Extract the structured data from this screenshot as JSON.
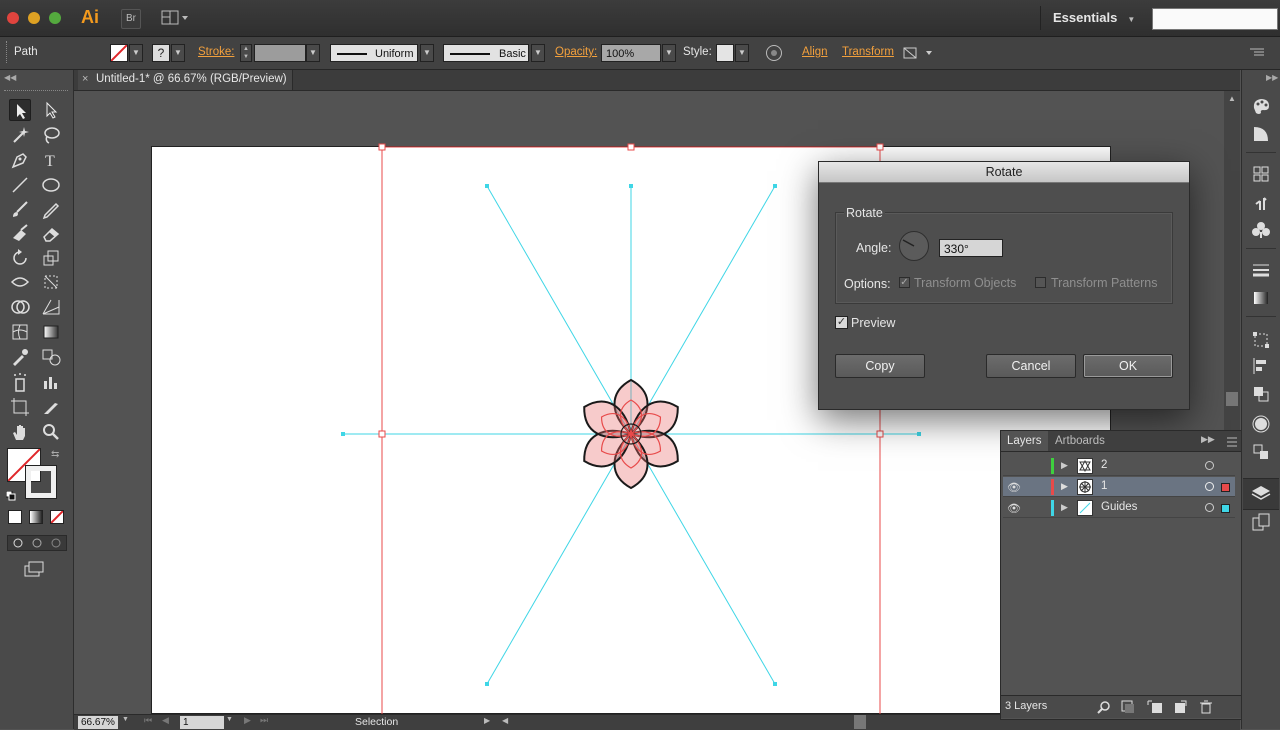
{
  "app": {
    "logo": "Ai",
    "bridge_label": "Br",
    "workspace": "Essentials",
    "search_placeholder": ""
  },
  "control_bar": {
    "selection_type": "Path",
    "stroke_label": "Stroke:",
    "stroke_profile": "Uniform",
    "brush": "Basic",
    "opacity_label": "Opacity:",
    "opacity_value": "100%",
    "style_label": "Style:",
    "align_label": "Align",
    "transform_label": "Transform"
  },
  "document": {
    "tab_title": "Untitled-1* @ 66.67% (RGB/Preview)",
    "close_glyph": "×"
  },
  "status_bar": {
    "zoom": "66.67%",
    "artboard_number": "1",
    "tool_status": "Selection"
  },
  "rotate_dialog": {
    "title": "Rotate",
    "group_label": "Rotate",
    "angle_label": "Angle:",
    "angle_value": "330°",
    "options_label": "Options:",
    "transform_objects": "Transform Objects",
    "transform_objects_checked": true,
    "transform_patterns": "Transform Patterns",
    "transform_patterns_checked": false,
    "preview_label": "Preview",
    "preview_checked": true,
    "copy_button": "Copy",
    "cancel_button": "Cancel",
    "ok_button": "OK"
  },
  "layers_panel": {
    "tabs": [
      "Layers",
      "Artboards"
    ],
    "layers": [
      {
        "name": "2",
        "visible": false,
        "color": "#3ecf3e",
        "selected": false
      },
      {
        "name": "1",
        "visible": true,
        "color": "#e84a4a",
        "selected": true
      },
      {
        "name": "Guides",
        "visible": true,
        "color": "#3fd6e6",
        "selected": false
      }
    ],
    "footer_count": "3 Layers"
  },
  "colors": {
    "accent_link": "#f2a03d",
    "guide": "#3fd6e6",
    "selection": "#e84a4a",
    "flower_fill": "#e86b6b"
  }
}
